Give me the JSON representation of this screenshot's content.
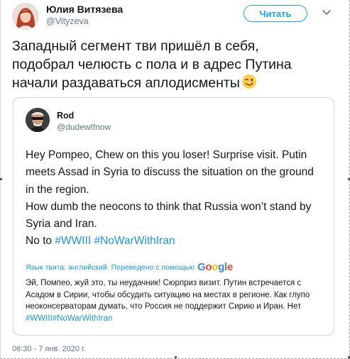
{
  "tweet": {
    "author_name": "Юлия Витязева",
    "author_handle": "@Vityzeva",
    "follow_label": "Читать",
    "text_lines": [
      "Западный сегмент тви пришёл в себя,",
      "подобрал челюсть с пола и в адрес Путина",
      "начали раздаваться аплодисменты"
    ],
    "emoji_icon": "winking-face-emoji",
    "timestamp": "06:30 - 7 янв. 2020 г."
  },
  "quote": {
    "author_name": "Rod",
    "author_handle": "@dudewtfnow",
    "lines": [
      "Hey Pompeo, Chew on this you loser! Surprise visit. Putin",
      "meets Assad in Syria to discuss the situation on the ground",
      "in the region.",
      "How dumb the neocons to think that Russia won’t stand by",
      "Syria and Iran."
    ],
    "last_line_prefix": "No to ",
    "hashtags": [
      "#WWIII",
      "#NoWarWithIran"
    ],
    "translate_label": "Язык твита: английский. Переведено с помощью",
    "translate_brand": "Google",
    "translation_lines": [
      "Эй, Помпео, жуй это, ты неудачник! Сюрприз визит. Путин встречается с",
      "Асадом в Сирии, чтобы обсудить ситуацию на местах в регионе. Как глупо",
      "неоконсерваторам думать, что Россия не поддержит Сирию и Иран. Нет"
    ],
    "translation_hashtags": "#WWIII#NoWarWithIran"
  },
  "colors": {
    "link": "#1b95e0",
    "follow": "#1da1f2",
    "secondary_text": "#657786",
    "border": "#ccd6dd",
    "google_blue": "#4285f4",
    "google_red": "#ea4335",
    "google_yellow": "#fbbc05",
    "google_green": "#34a853"
  }
}
